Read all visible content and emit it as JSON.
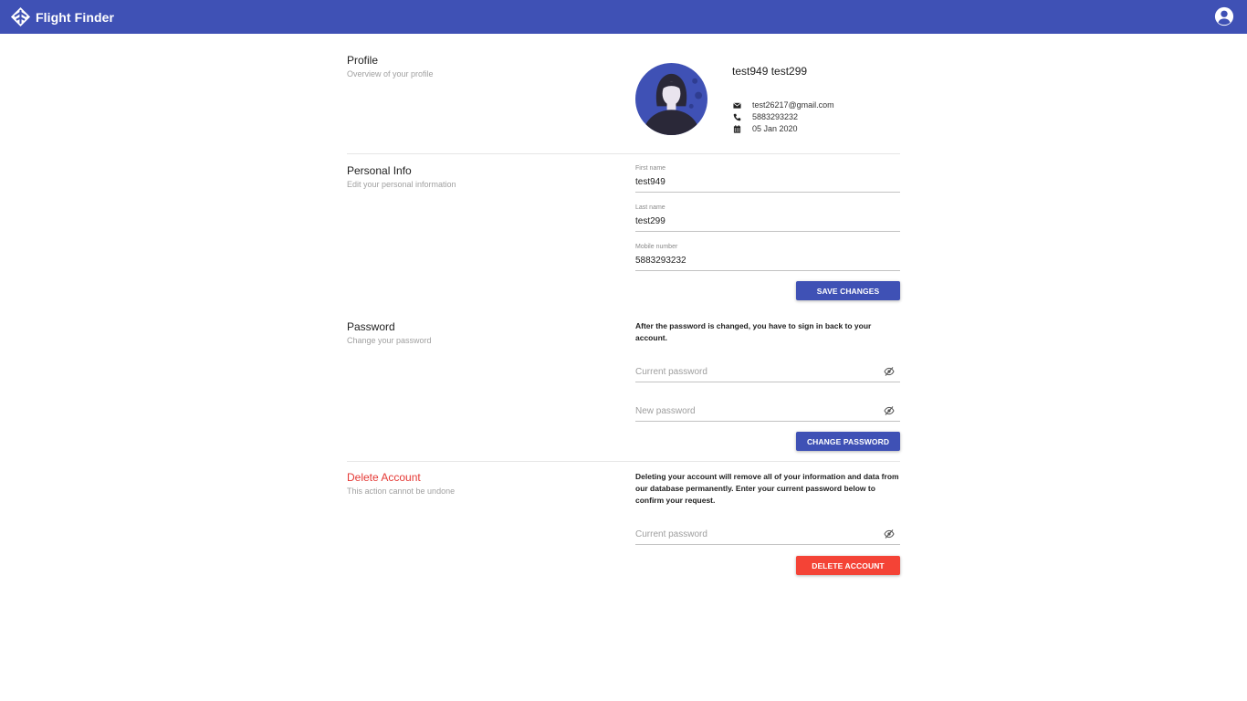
{
  "app": {
    "title": "Flight Finder",
    "logo_icon": "flight-finder-logo-icon",
    "account_icon": "account-circle-icon",
    "bar_color": "#3f51b5"
  },
  "profile": {
    "title": "Profile",
    "subtitle": "Overview of your profile",
    "name": "test949 test299",
    "email": "test26217@gmail.com",
    "phone": "5883293232",
    "date": "05 Jan 2020",
    "email_icon": "envelope-icon",
    "phone_icon": "phone-icon",
    "date_icon": "calendar-icon"
  },
  "personal_info": {
    "title": "Personal Info",
    "subtitle": "Edit your personal information",
    "first_name_label": "First name",
    "first_name_value": "test949",
    "last_name_label": "Last name",
    "last_name_value": "test299",
    "mobile_label": "Mobile number",
    "mobile_value": "5883293232",
    "save_label": "SAVE CHANGES"
  },
  "password": {
    "title": "Password",
    "subtitle": "Change your password",
    "note": "After the password is changed, you have to sign in back to your account.",
    "current_placeholder": "Current password",
    "new_placeholder": "New password",
    "visibility_icon": "eye-off-icon",
    "change_label": "CHANGE PASSWORD"
  },
  "delete_account": {
    "title": "Delete Account",
    "subtitle": "This action cannot be undone",
    "note": "Deleting your account will remove all of your information and data from our database permanently. Enter your current password below to confirm your request.",
    "current_placeholder": "Current password",
    "delete_label": "DELETE ACCOUNT",
    "danger_color": "#f44336"
  }
}
